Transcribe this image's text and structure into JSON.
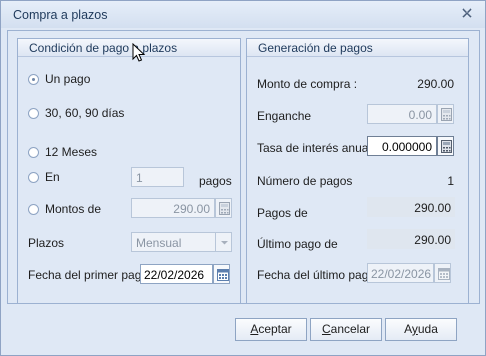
{
  "window": {
    "title": "Compra a plazos"
  },
  "left_group": {
    "title": "Condición de pago a plazos",
    "radio_un_pago": "Un pago",
    "radio_30_60_90": "30, 60, 90 días",
    "radio_12_meses": "12 Meses",
    "radio_en": "En",
    "en_value": "1",
    "en_suffix": "pagos",
    "radio_montos_de": "Montos de",
    "montos_value": "290.00",
    "plazos_label": "Plazos",
    "plazos_value": "Mensual",
    "fecha_label": "Fecha del primer pago",
    "fecha_value": "22/02/2026"
  },
  "right_group": {
    "title": "Generación de pagos",
    "monto_label": "Monto de compra :",
    "monto_value": "290.00",
    "enganche_label": "Enganche",
    "enganche_value": "0.00",
    "tasa_label": "Tasa de interés anual",
    "tasa_value": "0.000000",
    "numero_label": "Número de pagos",
    "numero_value": "1",
    "pagos_de_label": "Pagos de",
    "pagos_de_value": "290.00",
    "ultimo_label": "Último pago de",
    "ultimo_value": "290.00",
    "fecha_ultimo_label": "Fecha del último pago",
    "fecha_ultimo_value": "22/02/2026"
  },
  "buttons": {
    "aceptar_u": "A",
    "aceptar_rest": "ceptar",
    "cancelar_u": "C",
    "cancelar_rest": "ancelar",
    "ayuda_pre": "A",
    "ayuda_u": "y",
    "ayuda_rest": "uda"
  },
  "colors": {
    "window_bg": "#dfe8f5",
    "border": "#9cb1d1",
    "title_text": "#1e395b"
  }
}
